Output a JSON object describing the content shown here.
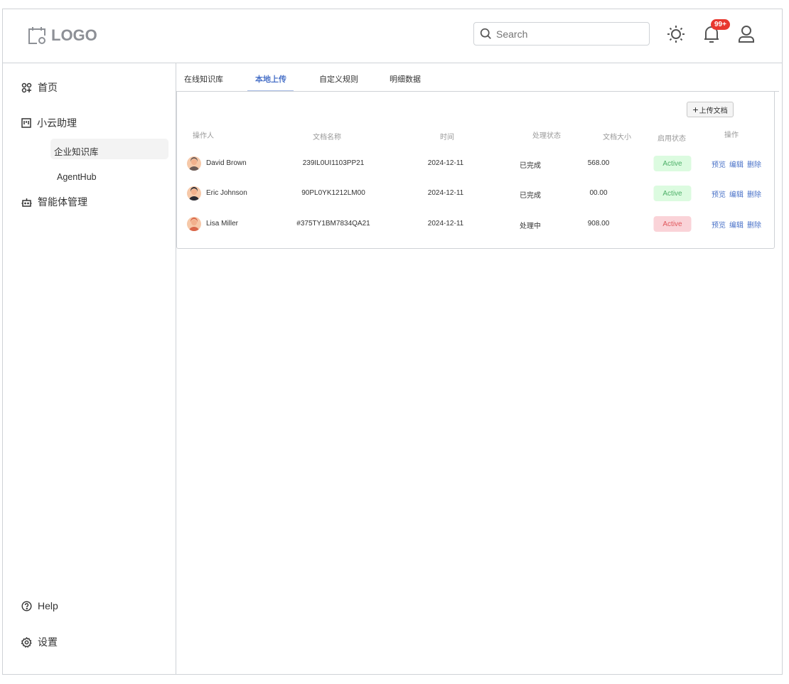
{
  "header": {
    "logo": "LOGO",
    "search_placeholder": "Search",
    "notification_count": "99+"
  },
  "sidebar": {
    "items": [
      {
        "label": "首页"
      },
      {
        "label": "小云助理"
      },
      {
        "label": "智能体管理"
      }
    ],
    "sub_items": [
      {
        "label": "企业知识库"
      },
      {
        "label": "AgentHub"
      }
    ],
    "bottom": [
      {
        "label": "Help"
      },
      {
        "label": "设置"
      }
    ]
  },
  "tabs": [
    {
      "label": "在线知识库"
    },
    {
      "label": "本地上传"
    },
    {
      "label": "自定义规则"
    },
    {
      "label": "明细数据"
    }
  ],
  "upload_label": "上传文档",
  "table": {
    "headers": [
      "操作人",
      "文档名称",
      "时间",
      "处理状态",
      "文档大小",
      "启用状态",
      "操作"
    ],
    "rows": [
      {
        "operator": "David Brown",
        "doc": "239IL0UI1103PP21",
        "time": "2024-12-11",
        "status": "已完成",
        "size": "568.00",
        "enabled": "Active",
        "enabled_color": "#4caf67",
        "avatar_color": "#6b5a55"
      },
      {
        "operator": "Eric Johnson",
        "doc": "90PL0YK1212LM00",
        "time": "2024-12-11",
        "status": "已完成",
        "size": "00.00",
        "enabled": "Active",
        "enabled_color": "#4caf67",
        "avatar_color": "#2b2b33"
      },
      {
        "operator": "Lisa Miller",
        "doc": "#375TY1BM7834QA21",
        "time": "2024-12-11",
        "status": "处理中",
        "size": "908.00",
        "enabled": "Active",
        "enabled_color": "#e0565b",
        "avatar_color": "#d9674a"
      }
    ],
    "actions": [
      "预览",
      "编辑",
      "删除"
    ]
  }
}
